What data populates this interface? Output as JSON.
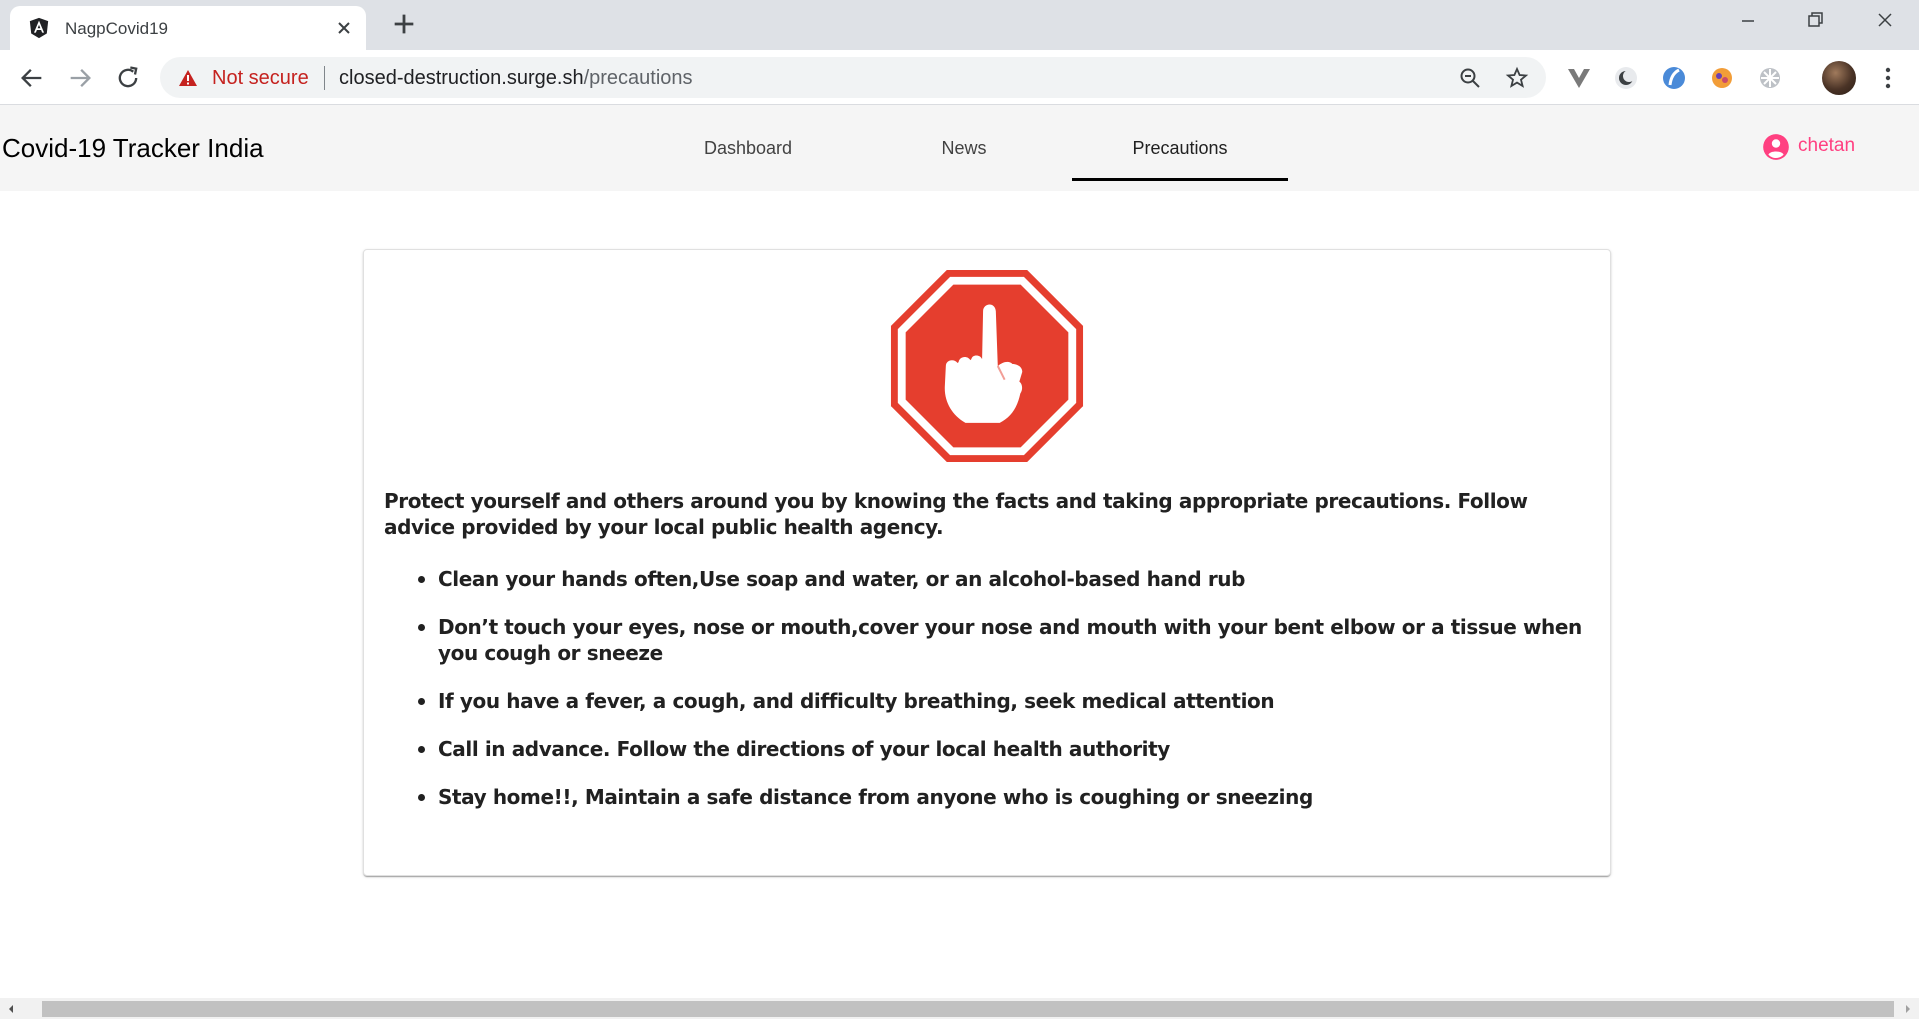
{
  "browser": {
    "tab_title": "NagpCovid19",
    "security_label": "Not secure",
    "url_host": "closed-destruction.surge.sh",
    "url_path": "/precautions"
  },
  "app": {
    "brand": "Covid-19 Tracker India",
    "nav": [
      {
        "label": "Dashboard"
      },
      {
        "label": "News"
      },
      {
        "label": "Precautions"
      }
    ],
    "active_nav": "Precautions",
    "user": "chetan",
    "accent_color": "#ff4081"
  },
  "content": {
    "intro": "Protect yourself and others around you by knowing the facts and taking appropriate precautions. Follow advice provided by your local public health agency.",
    "precautions": [
      "Clean your hands often,Use soap and water, or an alcohol-based hand rub",
      "Don’t touch your eyes, nose or mouth,cover your nose and mouth with your bent elbow or a tissue when you cough or sneeze",
      "If you have a fever, a cough, and difficulty breathing, seek medical attention",
      "Call in advance. Follow the directions of your local health authority",
      "Stay home!!, Maintain a safe distance from anyone who is coughing or sneezing"
    ],
    "image_icon": "stop-hand-icon"
  }
}
